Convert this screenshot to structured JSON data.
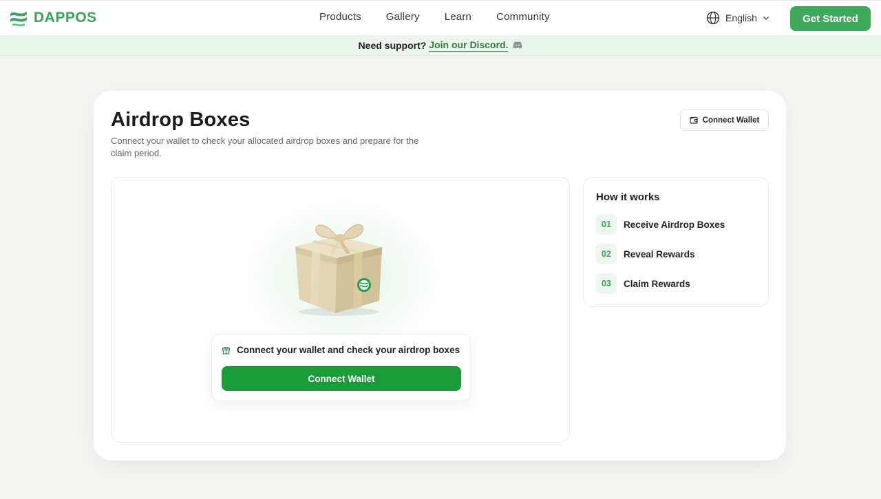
{
  "brand": {
    "name": "DAPPOS",
    "accent": "#3ea95a",
    "dark_accent": "#1b9a3a"
  },
  "nav": {
    "items": [
      "Products",
      "Gallery",
      "Learn",
      "Community"
    ]
  },
  "language": {
    "label": "English",
    "icon": "globe-icon"
  },
  "header": {
    "cta_label": "Get Started"
  },
  "support": {
    "text": "Need support?",
    "link": "Join our Discord.",
    "icon": "discord-icon"
  },
  "page": {
    "title": "Airdrop Boxes",
    "subtitle": "Connect your wallet to check your allocated airdrop boxes and prepare for the claim period.",
    "wallet_button": "Connect Wallet"
  },
  "airdrop": {
    "message": "Connect your wallet and check your airdrop boxes",
    "button": "Connect Wallet"
  },
  "how_it_works": {
    "title": "How it works",
    "steps": [
      {
        "num": "01",
        "label": "Receive Airdrop Boxes"
      },
      {
        "num": "02",
        "label": "Reveal Rewards"
      },
      {
        "num": "03",
        "label": "Claim Rewards"
      }
    ]
  }
}
